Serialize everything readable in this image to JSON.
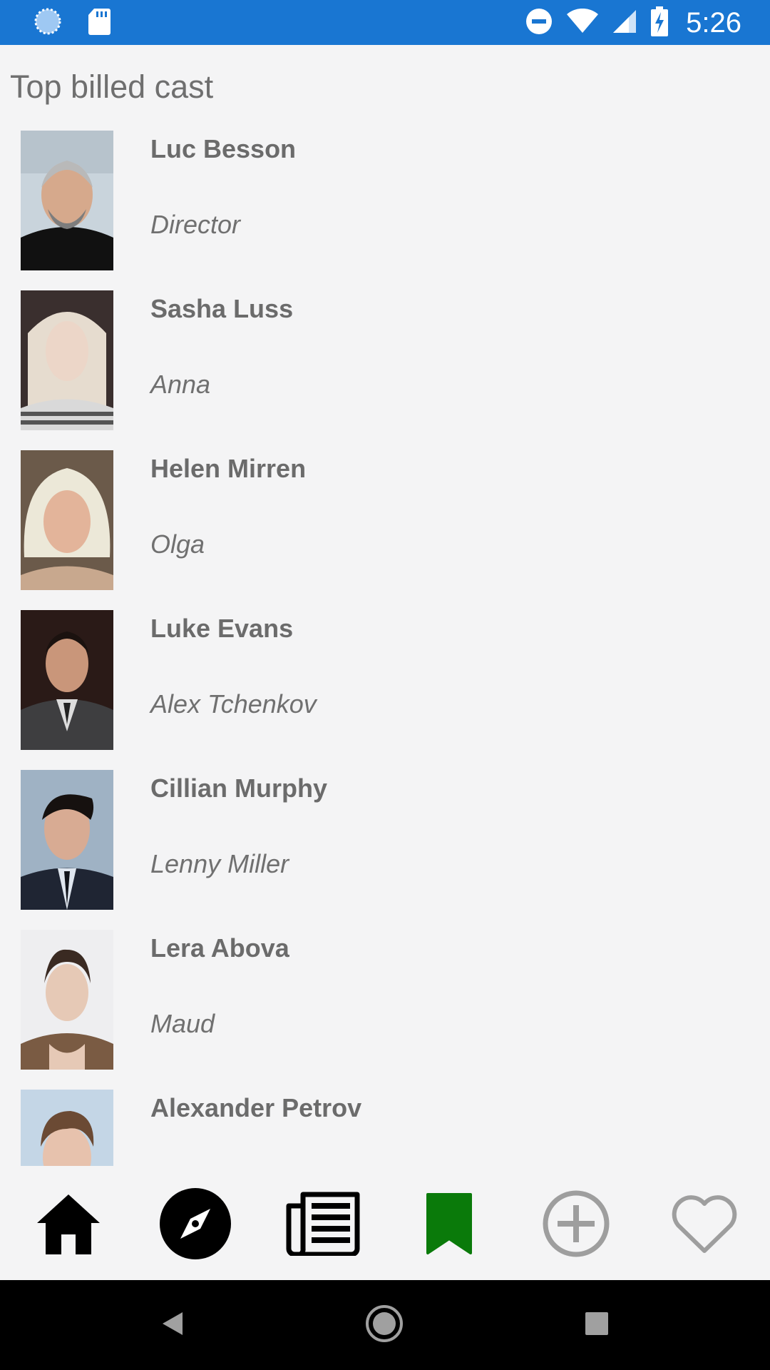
{
  "status_bar": {
    "time": "5:26",
    "left_icons": [
      "sync-icon",
      "sd-card-icon"
    ],
    "right_icons": [
      "do-not-disturb-icon",
      "wifi-icon",
      "cell-signal-icon",
      "battery-charging-icon"
    ],
    "color": "#1976d2"
  },
  "section": {
    "title": "Top billed cast"
  },
  "cast": [
    {
      "name": "Luc Besson",
      "role": "Director"
    },
    {
      "name": "Sasha Luss",
      "role": "Anna"
    },
    {
      "name": "Helen Mirren",
      "role": "Olga"
    },
    {
      "name": "Luke Evans",
      "role": "Alex Tchenkov"
    },
    {
      "name": "Cillian Murphy",
      "role": "Lenny Miller"
    },
    {
      "name": "Lera Abova",
      "role": "Maud"
    },
    {
      "name": "Alexander Petrov",
      "role": ""
    }
  ],
  "bottom_nav": {
    "items": [
      {
        "icon": "home-icon",
        "active": false
      },
      {
        "icon": "compass-icon",
        "active": false
      },
      {
        "icon": "news-icon",
        "active": false
      },
      {
        "icon": "bookmark-icon",
        "active": true
      },
      {
        "icon": "add-circle-icon",
        "active": false
      },
      {
        "icon": "heart-icon",
        "active": false
      }
    ],
    "active_color": "#0a7a0a"
  },
  "system_nav": {
    "items": [
      "back-icon",
      "home-circle-icon",
      "recents-icon"
    ]
  }
}
